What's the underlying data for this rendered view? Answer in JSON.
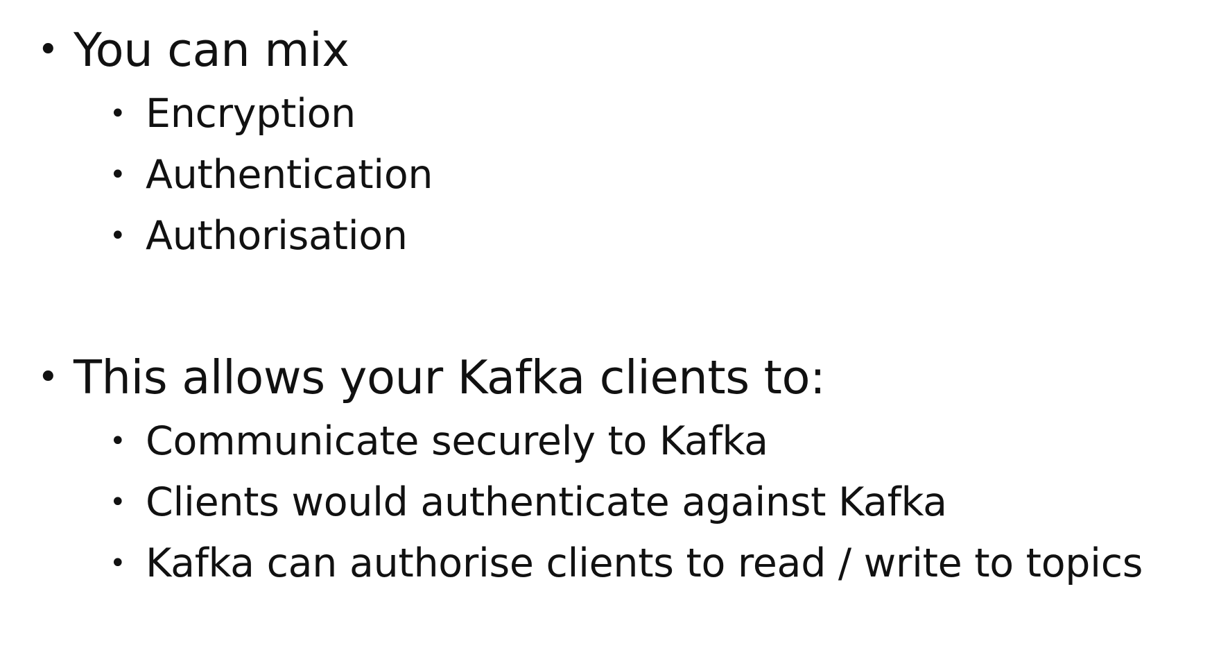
{
  "slide": {
    "sections": [
      {
        "heading": "You can mix",
        "items": [
          "Encryption",
          "Authentication",
          "Authorisation"
        ]
      },
      {
        "heading": "This allows your Kafka clients to:",
        "items": [
          "Communicate securely to Kafka",
          "Clients would authenticate against Kafka",
          "Kafka can authorise clients to read / write to topics"
        ]
      }
    ],
    "bullet_glyph": "•"
  }
}
